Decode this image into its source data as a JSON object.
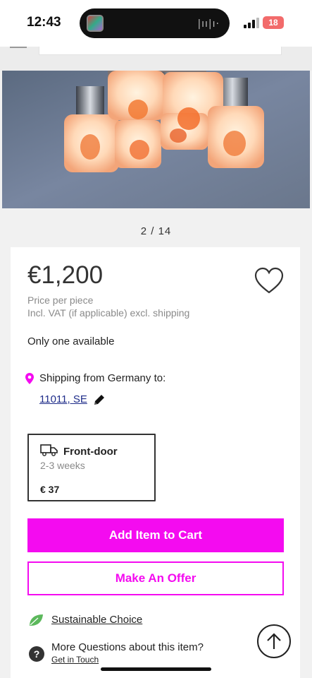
{
  "status_bar": {
    "time": "12:43",
    "battery": "18",
    "island_indicator": "|ıı|ı·"
  },
  "gallery": {
    "counter": "2 / 14",
    "image_alt": "Ceiling lamp with orange glass shades"
  },
  "product": {
    "price": "€1,200",
    "price_note": "Price per piece",
    "vat_note": "Incl. VAT (if applicable) excl. shipping",
    "availability": "Only one available"
  },
  "shipping": {
    "from_label": "Shipping from Germany to:",
    "destination": "11011, SE"
  },
  "delivery_option": {
    "title": "Front-door",
    "duration": "2-3 weeks",
    "price": "€ 37"
  },
  "actions": {
    "add_to_cart": "Add Item to Cart",
    "make_offer": "Make An Offer"
  },
  "footer_links": {
    "sustainable": "Sustainable Choice",
    "question": "More Questions about this item?",
    "contact": "Get in Touch"
  },
  "colors": {
    "accent": "#f40bf0",
    "pin": "#f40bf0",
    "leaf": "#5cb85c"
  }
}
